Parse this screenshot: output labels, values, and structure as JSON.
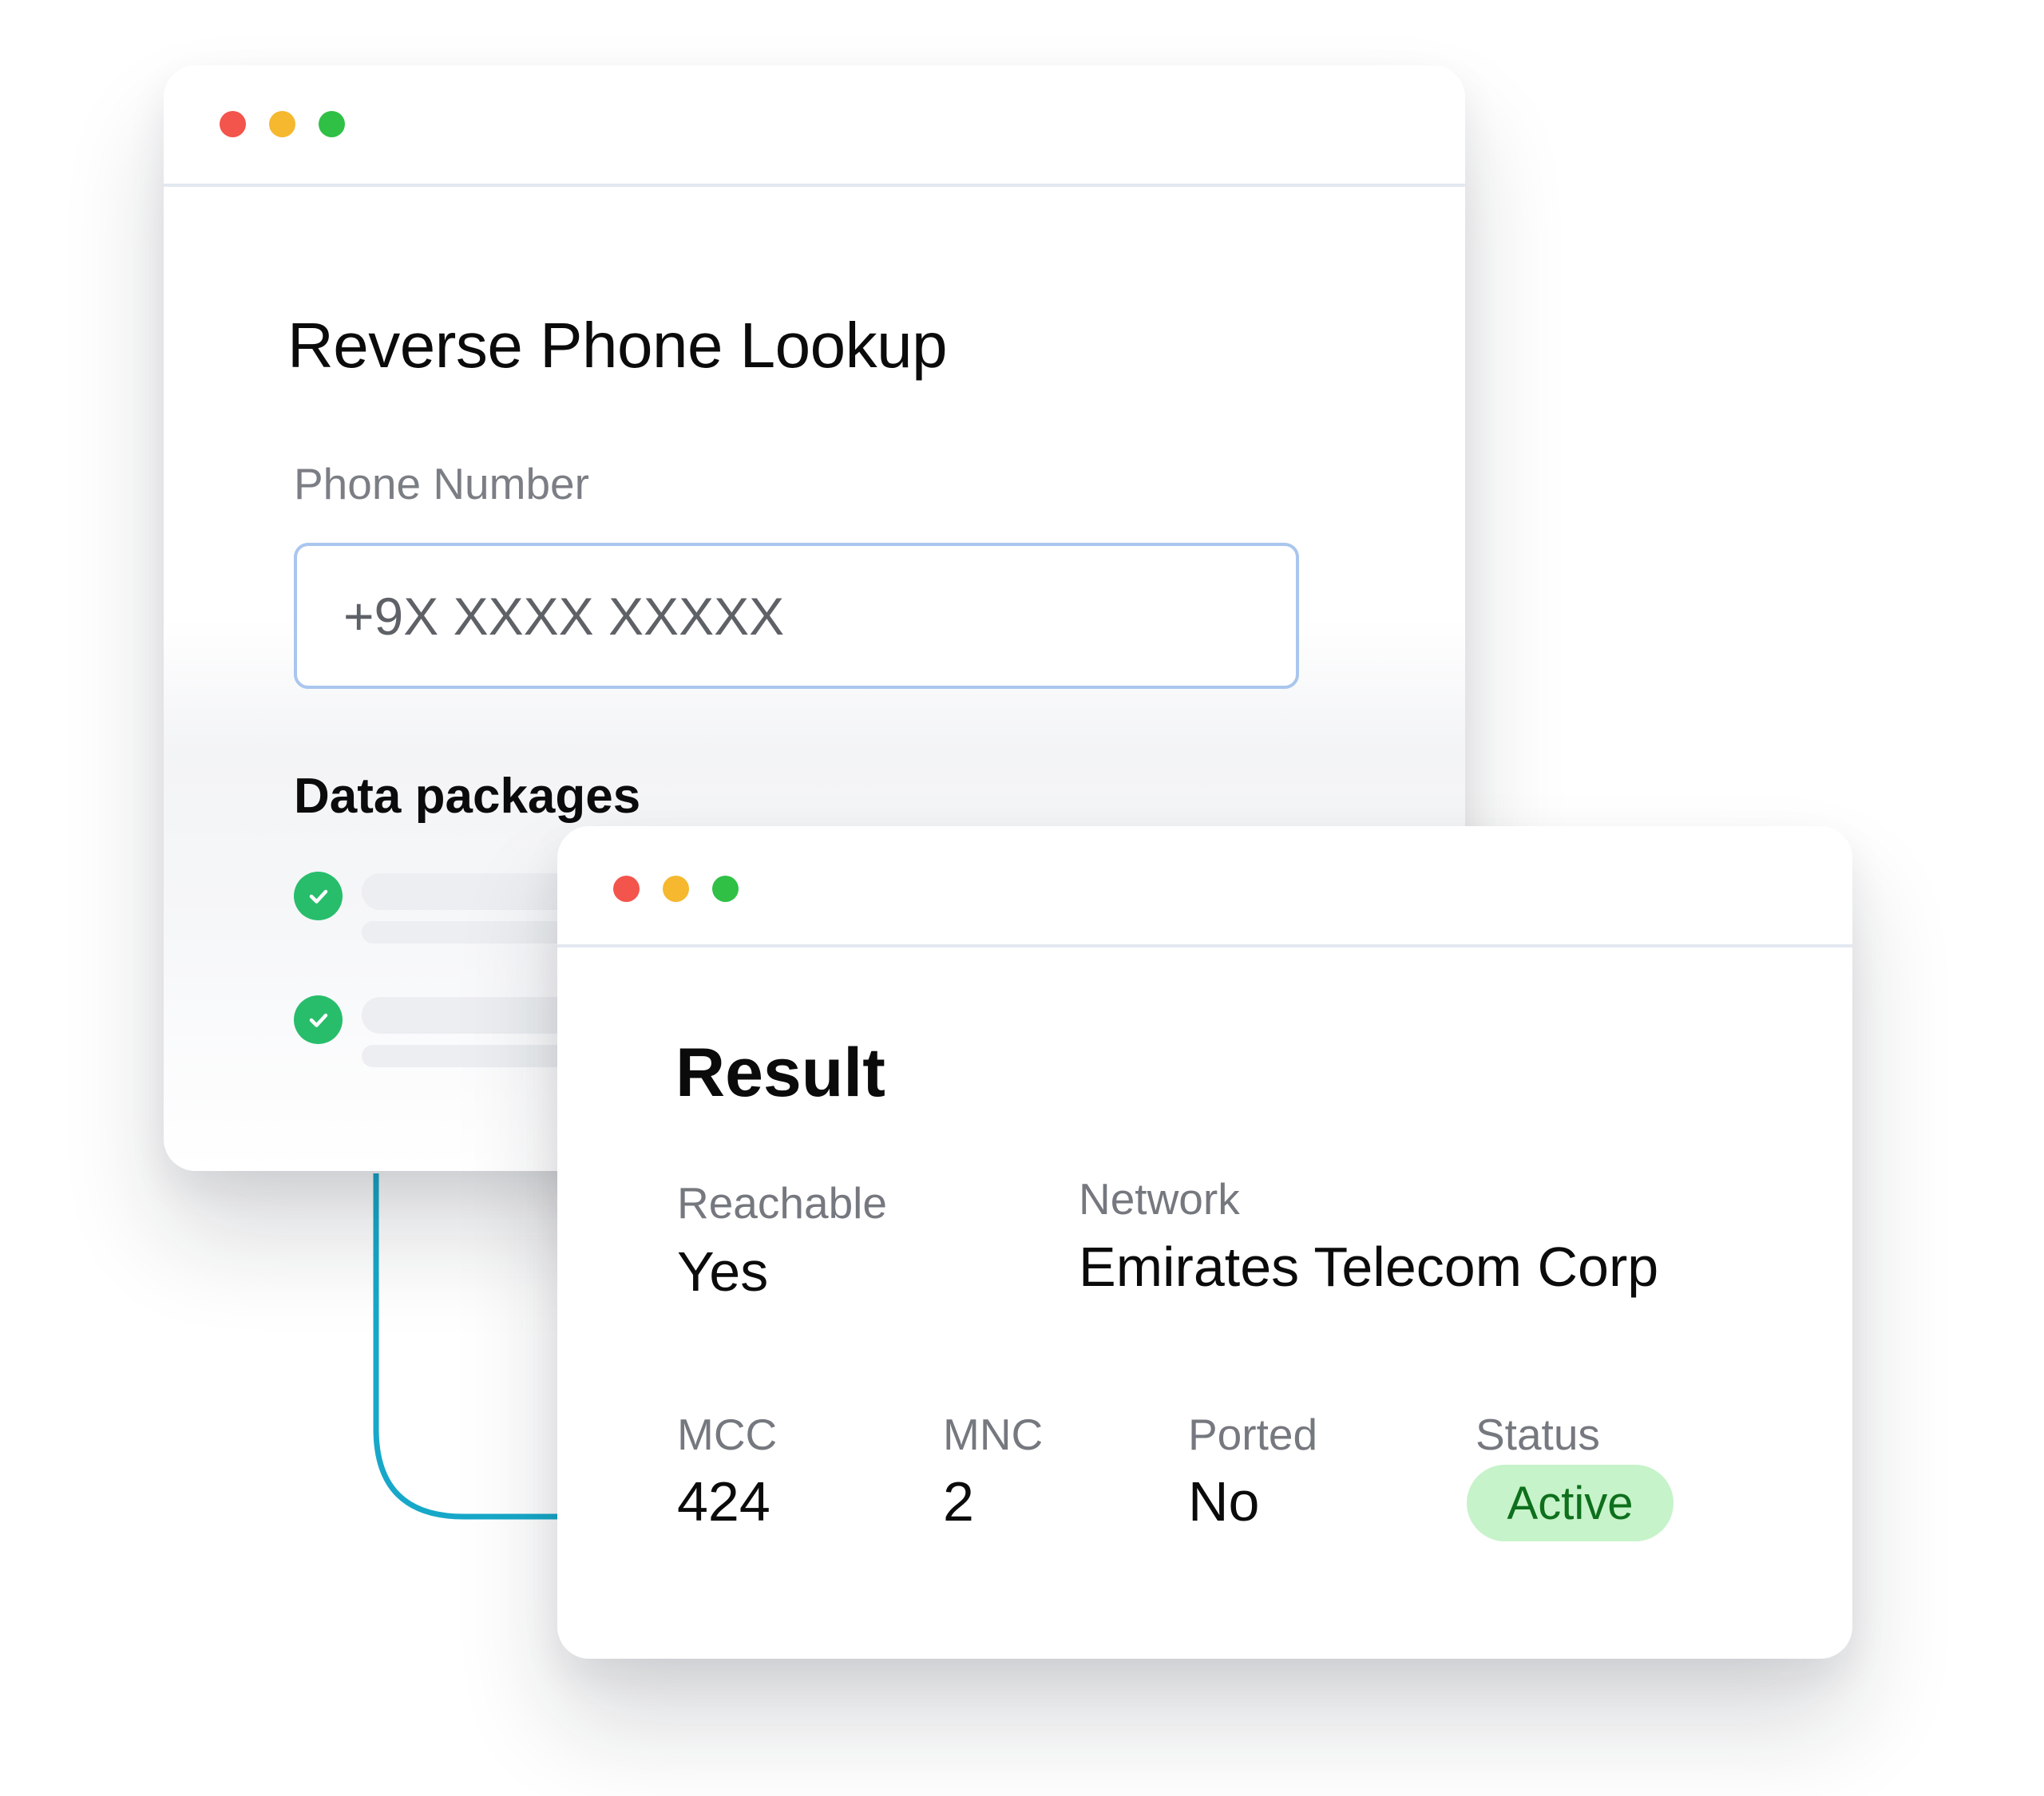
{
  "lookup_window": {
    "title": "Reverse Phone Lookup",
    "phone_label": "Phone Number",
    "phone_placeholder": "+9X XXXX XXXXX",
    "packages_title": "Data packages"
  },
  "result_window": {
    "title": "Result",
    "reachable": {
      "label": "Reachable",
      "value": "Yes"
    },
    "network": {
      "label": "Network",
      "value": "Emirates Telecom Corp"
    },
    "mcc": {
      "label": "MCC",
      "value": "424"
    },
    "mnc": {
      "label": "MNC",
      "value": "2"
    },
    "ported": {
      "label": "Ported",
      "value": "No"
    },
    "status": {
      "label": "Status",
      "value": "Active"
    }
  },
  "colors": {
    "window_close": "#f3544c",
    "window_minimize": "#f5b82e",
    "window_maximize": "#2fc045",
    "check_green": "#27bd6b",
    "input_border": "#a9c6ee",
    "status_badge_bg": "#c6f3c9",
    "status_badge_text": "#0e6f1c",
    "connector": "#17a8c9"
  },
  "icons": {
    "check": "check-circle-icon"
  }
}
